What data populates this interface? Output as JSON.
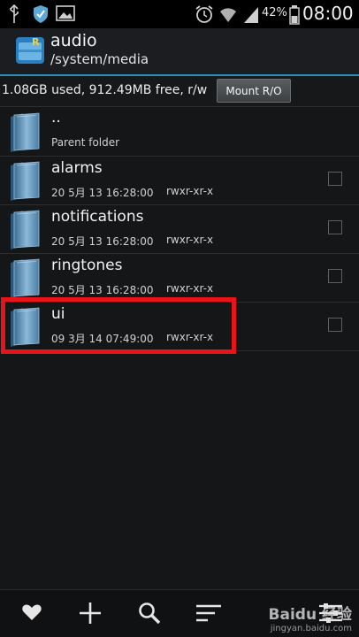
{
  "status_bar": {
    "battery_percent": "42%",
    "time": "08:00",
    "icons": [
      "usb-icon",
      "shield-icon",
      "picture-icon",
      "alarm-icon",
      "wifi-icon",
      "signal-icon",
      "battery-icon"
    ]
  },
  "title_bar": {
    "title": "audio",
    "path": "/system/media"
  },
  "info_bar": {
    "storage": "1.08GB used, 912.49MB free, r/w",
    "mount_button": "Mount R/O"
  },
  "files": [
    {
      "name": "..",
      "subtitle": "Parent folder"
    },
    {
      "name": "alarms",
      "date": "20 5月 13 16:28:00",
      "permissions": "rwxr-xr-x"
    },
    {
      "name": "notifications",
      "date": "20 5月 13 16:28:00",
      "permissions": "rwxr-xr-x"
    },
    {
      "name": "ringtones",
      "date": "20 5月 13 16:28:00",
      "permissions": "rwxr-xr-x"
    },
    {
      "name": "ui",
      "date": "09 3月 14 07:49:00",
      "permissions": "rwxr-xr-x"
    }
  ],
  "bottom_bar": {
    "icons": [
      "heart-icon",
      "plus-icon",
      "search-icon",
      "sort-icon",
      "settings-icon"
    ]
  },
  "watermark": {
    "logo": "Baidu 经验",
    "url": "jingyan.baidu.com"
  },
  "colors": {
    "accent": "#2c8fbf",
    "highlight": "#e8141a",
    "folder": "#6fa2c8"
  }
}
